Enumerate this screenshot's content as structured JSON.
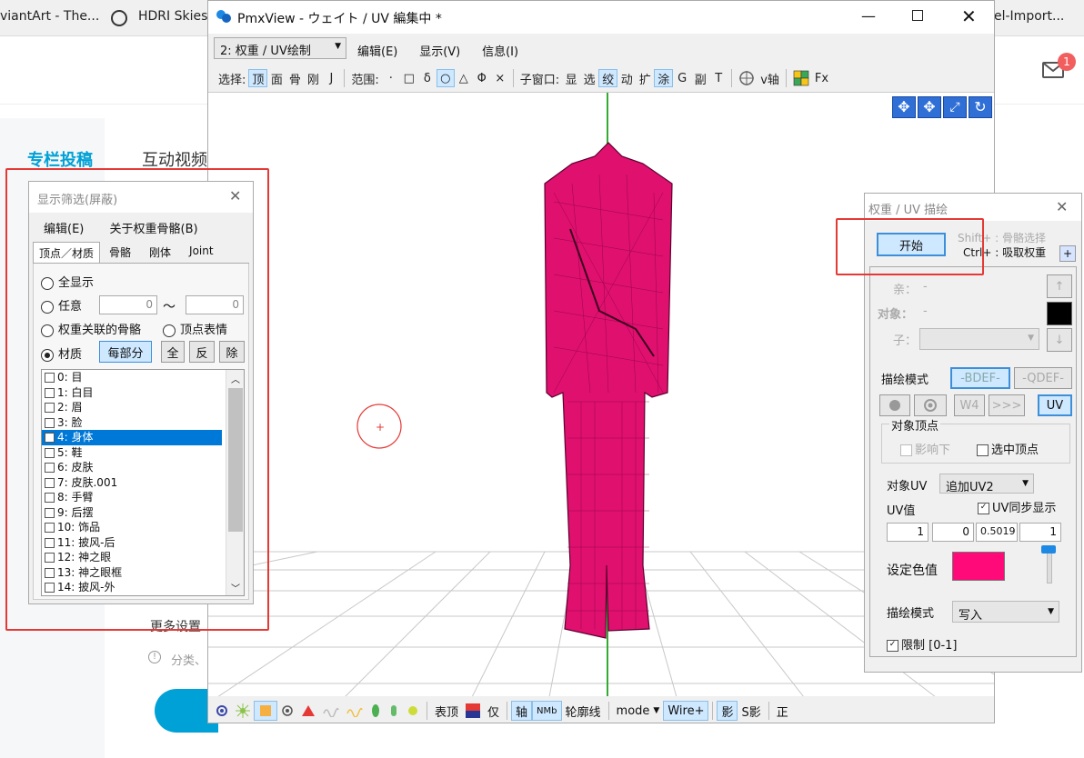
{
  "browser": {
    "tabs": [
      "viantArt - The...",
      "HDRI Skies",
      "el-Import..."
    ],
    "notification_count": "1"
  },
  "page": {
    "tabs": [
      "专栏投稿",
      "互动视频"
    ],
    "more_settings": "更多设置",
    "category_hint": "分类、"
  },
  "pmx": {
    "title": "PmxView  - ウェイト / UV 編集中 *",
    "mode_select": "2: 权重 / UV绘制",
    "menu": [
      "编辑(E)",
      "显示(V)",
      "信息(I)"
    ],
    "toolbar": {
      "select_label": "选择:",
      "select_items": [
        "顶",
        "面",
        "骨",
        "刚",
        "J"
      ],
      "range_label": "范围:",
      "range_items": [
        "·",
        "□",
        "δ",
        "○",
        "△",
        "Φ",
        "×"
      ],
      "subwin_label": "子窗口:",
      "subwin_items": [
        "显",
        "选",
        "绞",
        "动",
        "扩",
        "涂",
        "G",
        "副",
        "T"
      ],
      "v_axis": "v轴",
      "fx": "Fx"
    },
    "bottom_toolbar": [
      "表顶",
      "仅",
      "轴",
      "NMb",
      "轮廓线",
      "mode",
      "Wire+",
      "影",
      "S影",
      "正"
    ]
  },
  "filter": {
    "title": "显示筛选(屏蔽)",
    "menu": [
      "编辑(E)",
      "关于权重骨骼(B)"
    ],
    "tabs": [
      "顶点／材质",
      "骨骼",
      "刚体",
      "Joint"
    ],
    "show_all": "全显示",
    "arbitrary": "任意",
    "range_from": "0",
    "tilde": "〜",
    "range_to": "0",
    "weight_bones": "权重关联的骨骼",
    "vertex_morph": "顶点表情",
    "material": "材质",
    "per_part": "每部分",
    "all": "全",
    "invert": "反",
    "remove": "除",
    "materials": [
      {
        "label": "0: 目",
        "checked": false
      },
      {
        "label": "1: 白目",
        "checked": false
      },
      {
        "label": "2: 眉",
        "checked": false
      },
      {
        "label": "3: 脸",
        "checked": false
      },
      {
        "label": "4: 身体",
        "checked": true
      },
      {
        "label": "5: 鞋",
        "checked": false
      },
      {
        "label": "6: 皮肤",
        "checked": false
      },
      {
        "label": "7: 皮肤.001",
        "checked": false
      },
      {
        "label": "8: 手臂",
        "checked": false
      },
      {
        "label": "9: 后摆",
        "checked": false
      },
      {
        "label": "10: 饰品",
        "checked": false
      },
      {
        "label": "11: 披风-后",
        "checked": false
      },
      {
        "label": "12: 神之眼",
        "checked": false
      },
      {
        "label": "13: 神之眼框",
        "checked": false
      },
      {
        "label": "14: 披风-外",
        "checked": false
      }
    ]
  },
  "weight": {
    "title": "权重 / UV 描绘",
    "start": "开始",
    "hint_shift": "Shift+ : 骨骼选择",
    "hint_ctrl": "Ctrl+ : 吸取权重",
    "plus": "+",
    "parent_label": "亲：",
    "parent_value": "-",
    "target_label": "对象：",
    "target_value": "-",
    "child_label": "子：",
    "draw_mode_label": "描绘模式",
    "bdef": "-BDEF-",
    "qdef": "-QDEF-",
    "w4": "W4",
    "arrows": ">>>",
    "uv": "UV",
    "target_vertex": "对象顶点",
    "influence": "影响下",
    "selected_vertex": "选中顶点",
    "target_uv_label": "对象UV",
    "target_uv_value": "追加UV2",
    "uv_value_label": "UV值",
    "uv_sync": "UV同步显示",
    "uv_values": [
      "1",
      "0",
      "0.5019",
      "1"
    ],
    "set_color": "设定色值",
    "color": "#ff0a78",
    "paint_mode_label": "描绘模式",
    "paint_mode_value": "写入",
    "limit": "限制 [0-1]"
  },
  "colors": {
    "highlight": "#e53935",
    "model": "#e0106e",
    "accent_blue": "#00a1d6"
  }
}
